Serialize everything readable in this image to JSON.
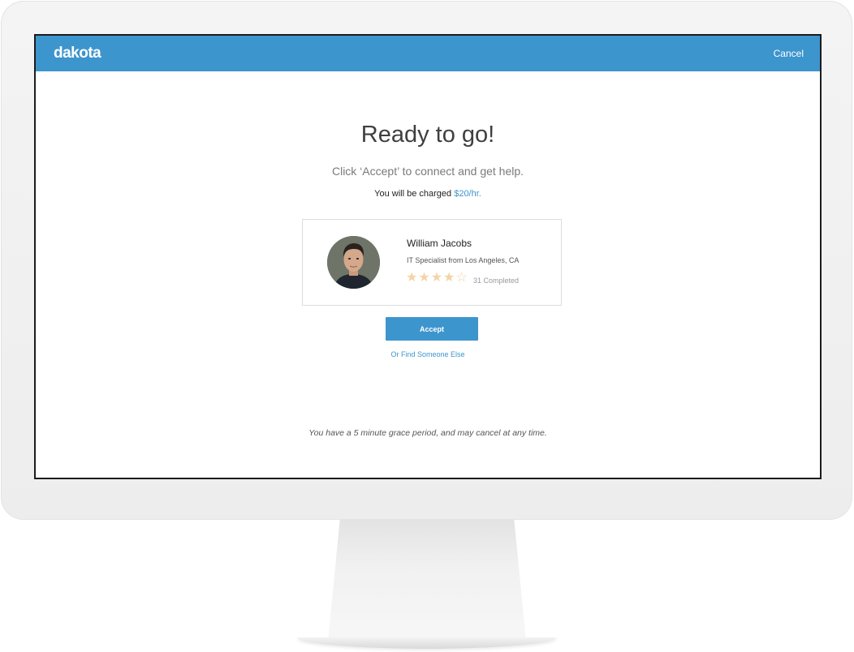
{
  "header": {
    "logo": "dakota",
    "cancel_label": "Cancel"
  },
  "main": {
    "title": "Ready to go!",
    "subtitle": "Click ‘Accept’ to connect and get help.",
    "charge_prefix": "You will be charged ",
    "charge_rate": "$20/hr."
  },
  "specialist": {
    "name": "William Jacobs",
    "role": "IT Specialist from Los Angeles, CA",
    "rating": 4,
    "rating_max": 5,
    "completed": "31 Completed"
  },
  "actions": {
    "accept_label": "Accept",
    "find_other_label": "Or Find Someone Else"
  },
  "footer": {
    "grace_note": "You have a 5 minute grace period, and may cancel at any time."
  },
  "colors": {
    "brand": "#3d95cd",
    "star": "#f5d3a6"
  }
}
